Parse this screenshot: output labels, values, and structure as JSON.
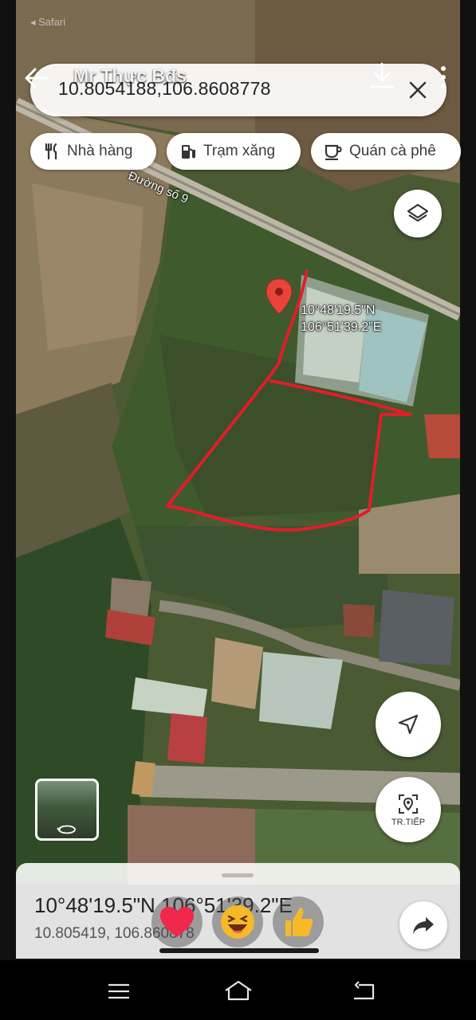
{
  "status": {
    "back_app": "◂ Safari"
  },
  "overlay": {
    "poster_name": "Mr Thực Bđs"
  },
  "search": {
    "query": "10.8054188,106.8608778"
  },
  "chips": [
    {
      "label": "Nhà hàng",
      "icon": "fork-knife-icon"
    },
    {
      "label": "Trạm xăng",
      "icon": "gas-pump-icon"
    },
    {
      "label": "Quán cà phê",
      "icon": "coffee-cup-icon"
    }
  ],
  "map": {
    "road_label": "Đường số 9",
    "pin_coords_lat": "10°48'19.5\"N",
    "pin_coords_lng": "106°51'39.2\"E",
    "pin_color": "#e8443a",
    "boundary_color": "#e01e2b"
  },
  "buttons": {
    "next_label": "TR.TIẾP"
  },
  "sheet": {
    "dms": "10°48'19.5\"N 106°51'39.2\"E",
    "decimal": "10.805419, 106.860878"
  },
  "reactions": [
    "heart",
    "haha",
    "like"
  ]
}
